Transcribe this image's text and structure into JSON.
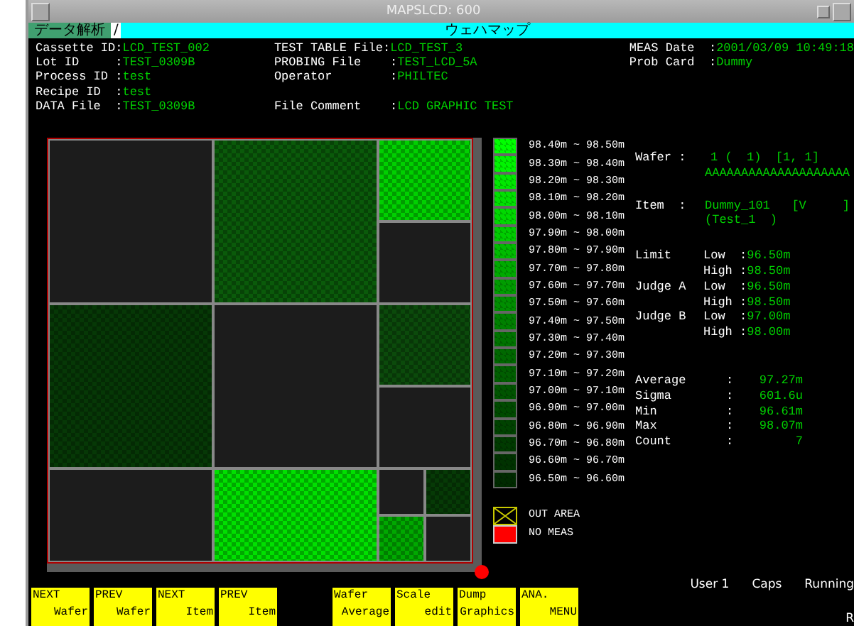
{
  "window": {
    "title": "MAPSLCD: 600"
  },
  "mode_bar": {
    "section": "データ解析",
    "separator": "/",
    "screen": "ウェハマップ"
  },
  "header": {
    "columns": [
      [
        {
          "label": "Cassette ID:",
          "value": "LCD_TEST_002"
        },
        {
          "label": "Lot ID     :",
          "value": "TEST_0309B"
        },
        {
          "label": "Process ID :",
          "value": "test"
        },
        {
          "label": "Recipe ID  :",
          "value": "test"
        },
        {
          "label": "DATA File  :",
          "value": "TEST_0309B"
        }
      ],
      [
        {
          "label": "TEST TABLE File:",
          "value": "LCD_TEST_3"
        },
        {
          "label": "PROBING File    :",
          "value": "TEST_LCD_5A"
        },
        {
          "label": "Operator        :",
          "value": "PHILTEC"
        },
        {
          "label": "File Comment    :",
          "value": "LCD GRAPHIC TEST",
          "gap": true
        }
      ],
      [
        {
          "label": "MEAS Date  :",
          "value": "2001/03/09 10:49:18"
        },
        {
          "label": "Prob Card  :",
          "value": "Dummy"
        }
      ]
    ]
  },
  "wafer_map": {
    "rows": [
      {
        "kind": "tall",
        "cells": [
          {
            "kind": "empty"
          },
          {
            "kind": "die",
            "color": "#0a5a0a"
          },
          {
            "kind": "stack",
            "children": [
              {
                "kind": "die",
                "color": "#00d000"
              },
              {
                "kind": "empty"
              }
            ]
          }
        ]
      },
      {
        "kind": "tall",
        "cells": [
          {
            "kind": "die",
            "color": "#063806"
          },
          {
            "kind": "empty"
          },
          {
            "kind": "stack",
            "children": [
              {
                "kind": "die",
                "color": "#0b4a0b"
              },
              {
                "kind": "empty"
              }
            ]
          }
        ]
      },
      {
        "kind": "short",
        "cells": [
          {
            "kind": "empty"
          },
          {
            "kind": "die",
            "color": "#00e000"
          },
          {
            "kind": "quad",
            "children": [
              {
                "kind": "empty"
              },
              {
                "kind": "die",
                "color": "#063a06"
              },
              {
                "kind": "die",
                "color": "#00a800"
              },
              {
                "kind": "empty"
              }
            ]
          }
        ]
      }
    ]
  },
  "legend": [
    {
      "range": "98.40m ~ 98.50m",
      "color": "#00ff00"
    },
    {
      "range": "98.30m ~ 98.40m",
      "color": "#00f400"
    },
    {
      "range": "98.20m ~ 98.30m",
      "color": "#00e800"
    },
    {
      "range": "98.10m ~ 98.20m",
      "color": "#00e000"
    },
    {
      "range": "98.00m ~ 98.10m",
      "color": "#00d800"
    },
    {
      "range": "97.90m ~ 98.00m",
      "color": "#00cc00"
    },
    {
      "range": "97.80m ~ 97.90m",
      "color": "#00bb00"
    },
    {
      "range": "97.70m ~ 97.80m",
      "color": "#00aa00"
    },
    {
      "range": "97.60m ~ 97.70m",
      "color": "#009c00"
    },
    {
      "range": "97.50m ~ 97.60m",
      "color": "#008e00"
    },
    {
      "range": "97.40m ~ 97.50m",
      "color": "#008000"
    },
    {
      "range": "97.30m ~ 97.40m",
      "color": "#007400"
    },
    {
      "range": "97.20m ~ 97.30m",
      "color": "#006800"
    },
    {
      "range": "97.10m ~ 97.20m",
      "color": "#005e00"
    },
    {
      "range": "97.00m ~ 97.10m",
      "color": "#005400"
    },
    {
      "range": "96.90m ~ 97.00m",
      "color": "#004a00"
    },
    {
      "range": "96.80m ~ 96.90m",
      "color": "#004200"
    },
    {
      "range": "96.70m ~ 96.80m",
      "color": "#003a00"
    },
    {
      "range": "96.60m ~ 96.70m",
      "color": "#003200"
    },
    {
      "range": "96.50m ~ 96.60m",
      "color": "#002a00"
    }
  ],
  "legend_extra": [
    {
      "kind": "out",
      "label": "OUT AREA"
    },
    {
      "kind": "nomeas",
      "label": "NO MEAS"
    }
  ],
  "info": {
    "wafer": {
      "label": "Wafer :",
      "lines": [
        "1 (  1)  [1, 1]",
        "AAAAAAAAAAAAAAAAAAAA"
      ]
    },
    "item": {
      "label": "Item  :",
      "lines": [
        "Dummy_101   [V     ]",
        "(Test_1  )"
      ]
    },
    "limits": [
      {
        "group": "Limit",
        "rows": [
          {
            "bound": "Low  :",
            "value": "96.50m"
          },
          {
            "bound": "High :",
            "value": "98.50m"
          }
        ]
      },
      {
        "group": "Judge A",
        "rows": [
          {
            "bound": "Low  :",
            "value": "96.50m"
          },
          {
            "bound": "High :",
            "value": "98.50m"
          }
        ]
      },
      {
        "group": "Judge B",
        "rows": [
          {
            "bound": "Low  :",
            "value": "97.00m"
          },
          {
            "bound": "High :",
            "value": "98.00m"
          }
        ]
      }
    ],
    "stats": [
      {
        "label": "Average",
        "sep": ":",
        "value": "97.27m"
      },
      {
        "label": "Sigma",
        "sep": ":",
        "value": "601.6u"
      },
      {
        "label": "Min",
        "sep": ":",
        "value": "96.61m"
      },
      {
        "label": "Max",
        "sep": ":",
        "value": "98.07m"
      },
      {
        "label": "Count",
        "sep": ":",
        "value": "7"
      }
    ]
  },
  "status": [
    "User 1",
    "Caps",
    "Running"
  ],
  "corner_mark": "R",
  "function_keys": [
    {
      "top": "NEXT",
      "bottom": "Wafer"
    },
    {
      "top": "PREV",
      "bottom": "Wafer"
    },
    {
      "top": "NEXT",
      "bottom": "Item"
    },
    {
      "top": "PREV",
      "bottom": "Item",
      "gap_after": true
    },
    {
      "top": "Wafer",
      "bottom": "Average"
    },
    {
      "top": "Scale",
      "bottom": "edit"
    },
    {
      "top": "Dump",
      "bottom": "Graphics"
    },
    {
      "top": "ANA.",
      "bottom": "MENU"
    }
  ]
}
